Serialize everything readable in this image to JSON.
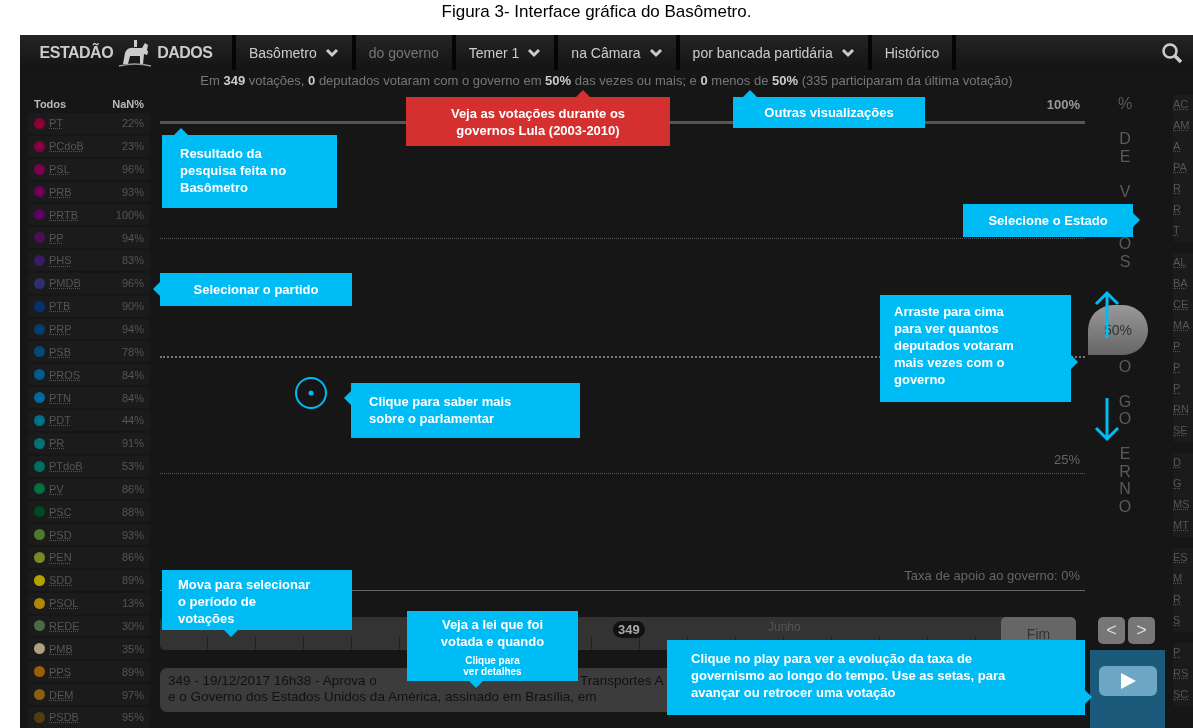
{
  "caption": "Figura 3- Interface gráfica do Basômetro.",
  "logo": {
    "left": "ESTADÃO",
    "right": "DADOS"
  },
  "nav": [
    {
      "label": "Basômetro",
      "dropdown": true,
      "dimmed": false
    },
    {
      "label": "do governo",
      "dropdown": false,
      "dimmed": true
    },
    {
      "label": "Temer 1",
      "dropdown": true,
      "dimmed": false
    },
    {
      "label": "na Câmara",
      "dropdown": true,
      "dimmed": false
    },
    {
      "label": "por bancada partidária",
      "dropdown": true,
      "dimmed": false
    },
    {
      "label": "Histórico",
      "dropdown": false,
      "dimmed": false
    }
  ],
  "summary": "Em **349** votações, **0** deputados votaram com o governo em **50%** das vezes ou mais; e **0** menos de **50%** (335 participaram da última votação)",
  "parties_header": {
    "label": "Todos",
    "value": "NaN%"
  },
  "parties": [
    {
      "name": "PT",
      "value": "22%",
      "color": "#8a0035"
    },
    {
      "name": "PCdoB",
      "value": "23%",
      "color": "#850042"
    },
    {
      "name": "PSL",
      "value": "96%",
      "color": "#7d004f"
    },
    {
      "name": "PRB",
      "value": "93%",
      "color": "#6e005c"
    },
    {
      "name": "PRTB",
      "value": "100%",
      "color": "#5e0060"
    },
    {
      "name": "PP",
      "value": "94%",
      "color": "#4a1052"
    },
    {
      "name": "PHS",
      "value": "83%",
      "color": "#3a1a60"
    },
    {
      "name": "PMDB",
      "value": "96%",
      "color": "#302c70"
    },
    {
      "name": "PTB",
      "value": "90%",
      "color": "#06306e"
    },
    {
      "name": "PRP",
      "value": "94%",
      "color": "#003e6e"
    },
    {
      "name": "PSB",
      "value": "78%",
      "color": "#004a7a"
    },
    {
      "name": "PROS",
      "value": "84%",
      "color": "#005a8c"
    },
    {
      "name": "PTN",
      "value": "84%",
      "color": "#00689a"
    },
    {
      "name": "PDT",
      "value": "44%",
      "color": "#007088"
    },
    {
      "name": "PR",
      "value": "91%",
      "color": "#007278"
    },
    {
      "name": "PTdoB",
      "value": "53%",
      "color": "#006e62"
    },
    {
      "name": "PV",
      "value": "86%",
      "color": "#007040"
    },
    {
      "name": "PSC",
      "value": "88%",
      "color": "#004a22"
    },
    {
      "name": "PSD",
      "value": "93%",
      "color": "#4e7a30"
    },
    {
      "name": "PEN",
      "value": "86%",
      "color": "#7a8a22"
    },
    {
      "name": "SDD",
      "value": "89%",
      "color": "#b4a200"
    },
    {
      "name": "PSOL",
      "value": "13%",
      "color": "#b08800"
    },
    {
      "name": "REDE",
      "value": "30%",
      "color": "#4a6a44"
    },
    {
      "name": "PMB",
      "value": "35%",
      "color": "#b0a080"
    },
    {
      "name": "PPS",
      "value": "89%",
      "color": "#a05c00"
    },
    {
      "name": "DEM",
      "value": "97%",
      "color": "#8a6010"
    },
    {
      "name": "PSDB",
      "value": "95%",
      "color": "#553c0e"
    }
  ],
  "chart": {
    "top_label": "100%",
    "quarter_label": "25%",
    "footer": "Taxa de apoio ao governo: 0%",
    "handle": "50%",
    "axis_label": [
      "% DE V",
      "OS",
      "O",
      "GO",
      "ERNO"
    ]
  },
  "states": [
    [
      "AC",
      "AM",
      "A",
      "PA",
      "R",
      "R",
      "T"
    ],
    [
      "AL",
      "BA",
      "CE",
      "MA",
      "P",
      "P",
      "P",
      "RN",
      "SE"
    ],
    [
      "D",
      "G",
      "MS",
      "MT"
    ],
    [
      "ES",
      "M",
      "R",
      "S"
    ],
    [
      "P",
      "RS",
      "SC"
    ]
  ],
  "timeline": {
    "label": "Junho",
    "current": "349",
    "end_button": "Fim",
    "prev": "<",
    "next": ">"
  },
  "vote": {
    "line1_start": "349 - 19/12/2017 16h38 - Aprova o",
    "line1_end": "Transportes A",
    "line2": "e o Governo dos Estados Unidos da América, assinado em Brasília, em"
  },
  "callouts": [
    {
      "text": "Veja as votações durante os governos Lula (2003-2010)",
      "color": "#d3302f"
    },
    {
      "text": "Outras visualizações",
      "color": "#00bcf5"
    },
    {
      "text": "Resultado da pesquisa feita no Basômetro",
      "color": "#00bcf5"
    },
    {
      "text": "Selecione o Estado",
      "color": "#00bcf5"
    },
    {
      "text": "Selecionar o partido",
      "color": "#00bcf5"
    },
    {
      "text": "Arraste para cima para ver quantos deputados votaram mais vezes com o governo",
      "color": "#00bcf5"
    },
    {
      "text": "Clique para saber mais sobre o parlamentar",
      "color": "#00bcf5"
    },
    {
      "text": "Mova  para selecionar o período de votações",
      "color": "#00bcf5"
    },
    {
      "text": "Veja a lei que foi votada e quando",
      "note": "Clique para ver detalhes",
      "color": "#00bcf5"
    },
    {
      "text": "Clique no play para ver a evolução da taxa de governismo ao longo do tempo. Use as setas, para avançar ou retrocer uma votação",
      "color": "#00bcf5"
    }
  ]
}
